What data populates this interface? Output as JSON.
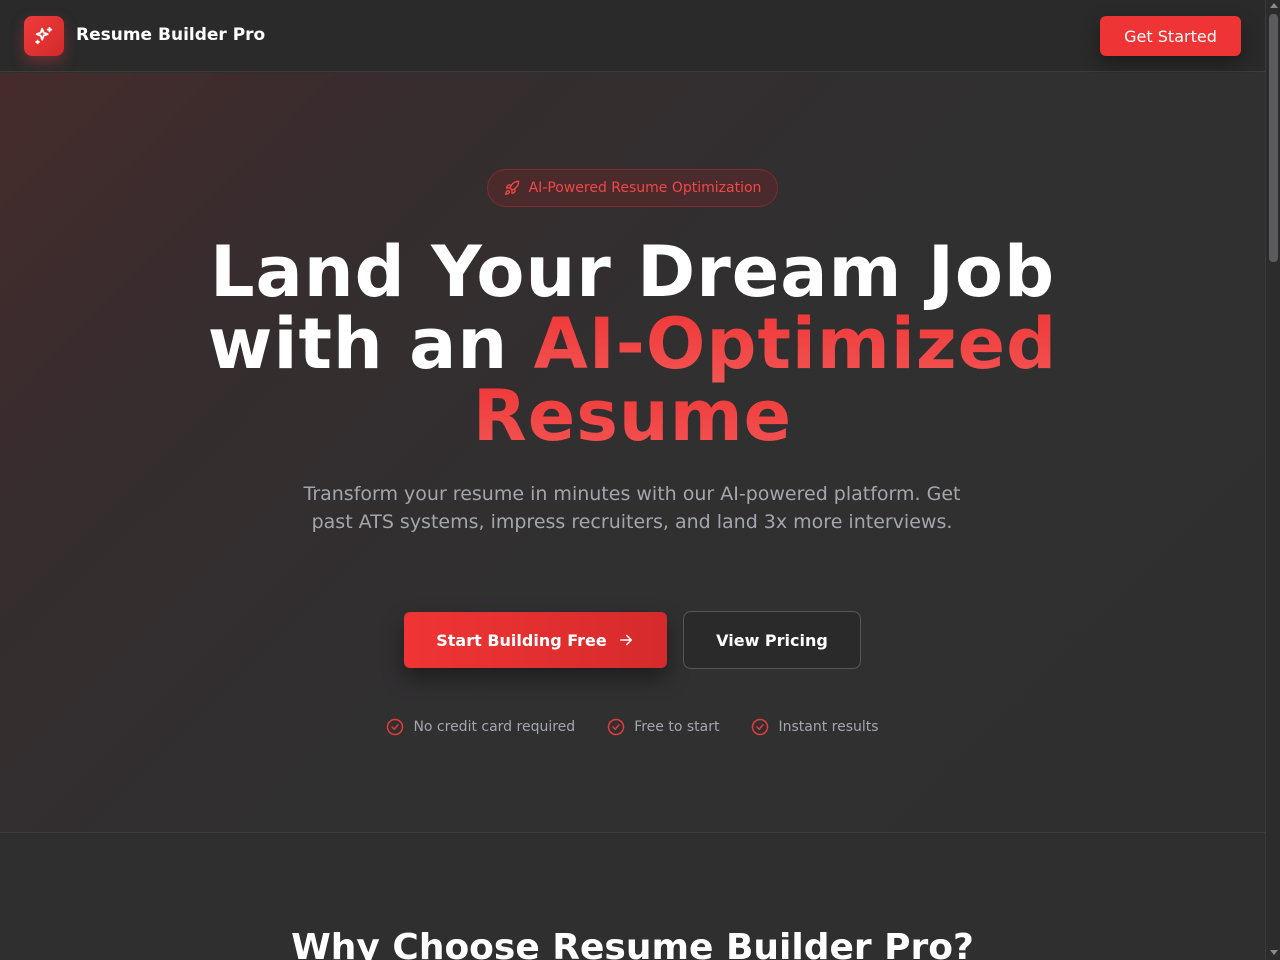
{
  "header": {
    "brand": "Resume Builder Pro",
    "logo_icon": "sparkle-icon",
    "cta_label": "Get Started"
  },
  "hero": {
    "badge": {
      "icon": "rocket-icon",
      "label": "AI-Powered Resume Optimization"
    },
    "headline_line1": "Land Your Dream Job",
    "headline_line2_plain": "with an ",
    "headline_line2_accent": "AI-Optimized",
    "headline_line3_accent": "Resume",
    "subtitle": "Transform your resume in minutes with our AI-powered platform. Get past ATS systems, impress recruiters, and land 3x more interviews.",
    "primary_button": {
      "label": "Start Building Free",
      "icon": "arrow-right-icon"
    },
    "secondary_button": {
      "label": "View Pricing"
    },
    "features": [
      {
        "icon": "check-circle-icon",
        "label": "No credit card required"
      },
      {
        "icon": "check-circle-icon",
        "label": "Free to start"
      },
      {
        "icon": "check-circle-icon",
        "label": "Instant results"
      }
    ]
  },
  "section": {
    "title": "Why Choose Resume Builder Pro?"
  },
  "colors": {
    "accent": "#ee3434",
    "background": "#2f2f30",
    "header_bg": "#2a2a2b",
    "muted_text": "#a4a6ad"
  }
}
